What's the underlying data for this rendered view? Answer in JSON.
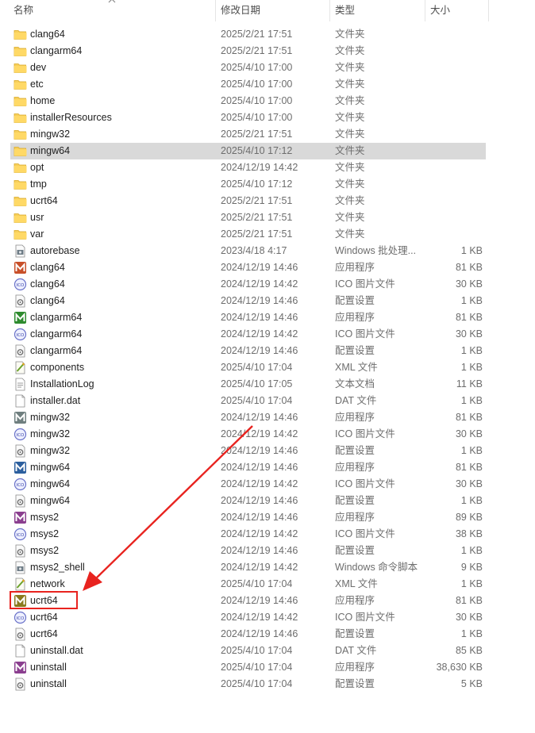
{
  "columns": {
    "name": "名称",
    "date": "修改日期",
    "type": "类型",
    "size": "大小"
  },
  "colors": {
    "accent_red": "#e8231f",
    "selected_row": "#d9d9d9"
  },
  "files": [
    {
      "name": "clang64",
      "date": "2025/2/21 17:51",
      "type": "文件夹",
      "size": "",
      "icon": "folder-icon"
    },
    {
      "name": "clangarm64",
      "date": "2025/2/21 17:51",
      "type": "文件夹",
      "size": "",
      "icon": "folder-icon"
    },
    {
      "name": "dev",
      "date": "2025/4/10 17:00",
      "type": "文件夹",
      "size": "",
      "icon": "folder-icon"
    },
    {
      "name": "etc",
      "date": "2025/4/10 17:00",
      "type": "文件夹",
      "size": "",
      "icon": "folder-icon"
    },
    {
      "name": "home",
      "date": "2025/4/10 17:00",
      "type": "文件夹",
      "size": "",
      "icon": "folder-icon"
    },
    {
      "name": "installerResources",
      "date": "2025/4/10 17:00",
      "type": "文件夹",
      "size": "",
      "icon": "folder-icon"
    },
    {
      "name": "mingw32",
      "date": "2025/2/21 17:51",
      "type": "文件夹",
      "size": "",
      "icon": "folder-icon"
    },
    {
      "name": "mingw64",
      "date": "2025/4/10 17:12",
      "type": "文件夹",
      "size": "",
      "icon": "folder-icon",
      "selected": true
    },
    {
      "name": "opt",
      "date": "2024/12/19 14:42",
      "type": "文件夹",
      "size": "",
      "icon": "folder-icon"
    },
    {
      "name": "tmp",
      "date": "2025/4/10 17:12",
      "type": "文件夹",
      "size": "",
      "icon": "folder-icon"
    },
    {
      "name": "ucrt64",
      "date": "2025/2/21 17:51",
      "type": "文件夹",
      "size": "",
      "icon": "folder-icon"
    },
    {
      "name": "usr",
      "date": "2025/2/21 17:51",
      "type": "文件夹",
      "size": "",
      "icon": "folder-icon"
    },
    {
      "name": "var",
      "date": "2025/2/21 17:51",
      "type": "文件夹",
      "size": "",
      "icon": "folder-icon"
    },
    {
      "name": "autorebase",
      "date": "2023/4/18 4:17",
      "type": "Windows 批处理...",
      "size": "1 KB",
      "icon": "batch-file-icon"
    },
    {
      "name": "clang64",
      "date": "2024/12/19 14:46",
      "type": "应用程序",
      "size": "81 KB",
      "icon": "app-icon",
      "color": "#c8502a"
    },
    {
      "name": "clang64",
      "date": "2024/12/19 14:42",
      "type": "ICO 图片文件",
      "size": "30 KB",
      "icon": "ico-file-icon"
    },
    {
      "name": "clang64",
      "date": "2024/12/19 14:46",
      "type": "配置设置",
      "size": "1 KB",
      "icon": "config-file-icon"
    },
    {
      "name": "clangarm64",
      "date": "2024/12/19 14:46",
      "type": "应用程序",
      "size": "81 KB",
      "icon": "app-icon",
      "color": "#2e8b2e"
    },
    {
      "name": "clangarm64",
      "date": "2024/12/19 14:42",
      "type": "ICO 图片文件",
      "size": "30 KB",
      "icon": "ico-file-icon"
    },
    {
      "name": "clangarm64",
      "date": "2024/12/19 14:46",
      "type": "配置设置",
      "size": "1 KB",
      "icon": "config-file-icon"
    },
    {
      "name": "components",
      "date": "2025/4/10 17:04",
      "type": "XML 文件",
      "size": "1 KB",
      "icon": "xml-file-icon"
    },
    {
      "name": "InstallationLog",
      "date": "2025/4/10 17:05",
      "type": "文本文档",
      "size": "11 KB",
      "icon": "text-file-icon"
    },
    {
      "name": "installer.dat",
      "date": "2025/4/10 17:04",
      "type": "DAT 文件",
      "size": "1 KB",
      "icon": "blank-file-icon"
    },
    {
      "name": "mingw32",
      "date": "2024/12/19 14:46",
      "type": "应用程序",
      "size": "81 KB",
      "icon": "app-icon",
      "color": "#6f7f7f"
    },
    {
      "name": "mingw32",
      "date": "2024/12/19 14:42",
      "type": "ICO 图片文件",
      "size": "30 KB",
      "icon": "ico-file-icon"
    },
    {
      "name": "mingw32",
      "date": "2024/12/19 14:46",
      "type": "配置设置",
      "size": "1 KB",
      "icon": "config-file-icon"
    },
    {
      "name": "mingw64",
      "date": "2024/12/19 14:46",
      "type": "应用程序",
      "size": "81 KB",
      "icon": "app-icon",
      "color": "#2c5f9e"
    },
    {
      "name": "mingw64",
      "date": "2024/12/19 14:42",
      "type": "ICO 图片文件",
      "size": "30 KB",
      "icon": "ico-file-icon"
    },
    {
      "name": "mingw64",
      "date": "2024/12/19 14:46",
      "type": "配置设置",
      "size": "1 KB",
      "icon": "config-file-icon"
    },
    {
      "name": "msys2",
      "date": "2024/12/19 14:46",
      "type": "应用程序",
      "size": "89 KB",
      "icon": "app-icon",
      "color": "#8b3f8f"
    },
    {
      "name": "msys2",
      "date": "2024/12/19 14:42",
      "type": "ICO 图片文件",
      "size": "38 KB",
      "icon": "ico-file-icon"
    },
    {
      "name": "msys2",
      "date": "2024/12/19 14:46",
      "type": "配置设置",
      "size": "1 KB",
      "icon": "config-file-icon"
    },
    {
      "name": "msys2_shell",
      "date": "2024/12/19 14:42",
      "type": "Windows 命令脚本",
      "size": "9 KB",
      "icon": "cmd-script-icon"
    },
    {
      "name": "network",
      "date": "2025/4/10 17:04",
      "type": "XML 文件",
      "size": "1 KB",
      "icon": "xml-file-icon"
    },
    {
      "name": "ucrt64",
      "date": "2024/12/19 14:46",
      "type": "应用程序",
      "size": "81 KB",
      "icon": "app-icon",
      "color": "#8a7a1e",
      "highlighted": true
    },
    {
      "name": "ucrt64",
      "date": "2024/12/19 14:42",
      "type": "ICO 图片文件",
      "size": "30 KB",
      "icon": "ico-file-icon"
    },
    {
      "name": "ucrt64",
      "date": "2024/12/19 14:46",
      "type": "配置设置",
      "size": "1 KB",
      "icon": "config-file-icon"
    },
    {
      "name": "uninstall.dat",
      "date": "2025/4/10 17:04",
      "type": "DAT 文件",
      "size": "85 KB",
      "icon": "blank-file-icon"
    },
    {
      "name": "uninstall",
      "date": "2025/4/10 17:04",
      "type": "应用程序",
      "size": "38,630 KB",
      "icon": "app-icon",
      "color": "#8b3f8f"
    },
    {
      "name": "uninstall",
      "date": "2025/4/10 17:04",
      "type": "配置设置",
      "size": "5 KB",
      "icon": "config-file-icon"
    }
  ]
}
